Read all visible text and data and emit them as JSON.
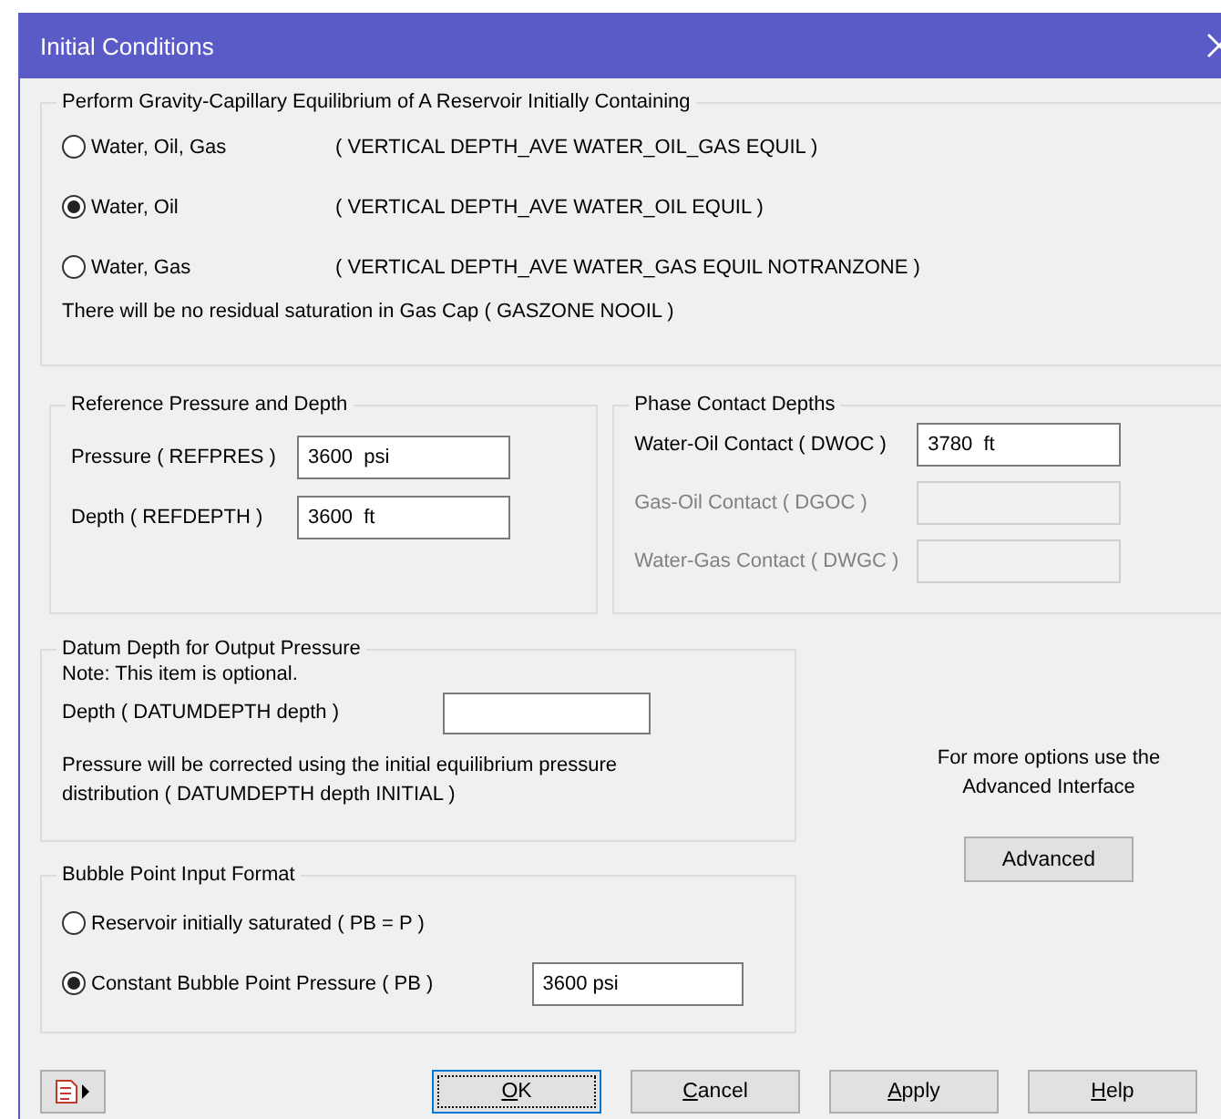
{
  "window": {
    "title": "Initial Conditions"
  },
  "equilibrium": {
    "title": "Perform Gravity-Capillary Equilibrium of A Reservoir Initially Containing",
    "options": [
      {
        "label": "Water, Oil, Gas",
        "keyword": "( VERTICAL DEPTH_AVE WATER_OIL_GAS EQUIL )",
        "selected": false
      },
      {
        "label": "Water, Oil",
        "keyword": "( VERTICAL DEPTH_AVE WATER_OIL EQUIL )",
        "selected": true
      },
      {
        "label": "Water, Gas",
        "keyword": "( VERTICAL DEPTH_AVE WATER_GAS EQUIL NOTRANZONE )",
        "selected": false
      }
    ],
    "note": "There will be no residual saturation in Gas Cap ( GASZONE NOOIL )"
  },
  "reference": {
    "title": "Reference Pressure and Depth",
    "fields": [
      {
        "label": "Pressure ( REFPRES )",
        "value": "3600  psi"
      },
      {
        "label": "Depth ( REFDEPTH )",
        "value": "3600  ft"
      }
    ]
  },
  "contacts": {
    "title": "Phase Contact Depths",
    "fields": [
      {
        "label": "Water-Oil Contact ( DWOC )",
        "value": "3780  ft",
        "disabled": false
      },
      {
        "label": "Gas-Oil Contact ( DGOC )",
        "disabled": true
      },
      {
        "label": "Water-Gas Contact ( DWGC )",
        "disabled": true
      }
    ]
  },
  "datum": {
    "title": "Datum Depth for Output Pressure",
    "note": "Note: This item is optional.",
    "field": {
      "label": "Depth ( DATUMDEPTH depth )"
    },
    "description": "Pressure will be corrected using the initial equilibrium pressure distribution ( DATUMDEPTH depth INITIAL )"
  },
  "bubble": {
    "title": "Bubble Point Input Format",
    "options": [
      {
        "label": "Reservoir initially saturated ( PB = P )",
        "selected": false
      },
      {
        "label": "Constant Bubble Point Pressure ( PB )",
        "selected": true,
        "value": "3600 psi"
      }
    ]
  },
  "advanced": {
    "hint": "For more options use the Advanced Interface",
    "button": "Advanced"
  },
  "buttons": [
    {
      "label": "OK",
      "default": true
    },
    {
      "label": "Cancel",
      "default": false
    },
    {
      "label": "Apply",
      "default": false
    },
    {
      "label": "Help",
      "default": false
    }
  ]
}
